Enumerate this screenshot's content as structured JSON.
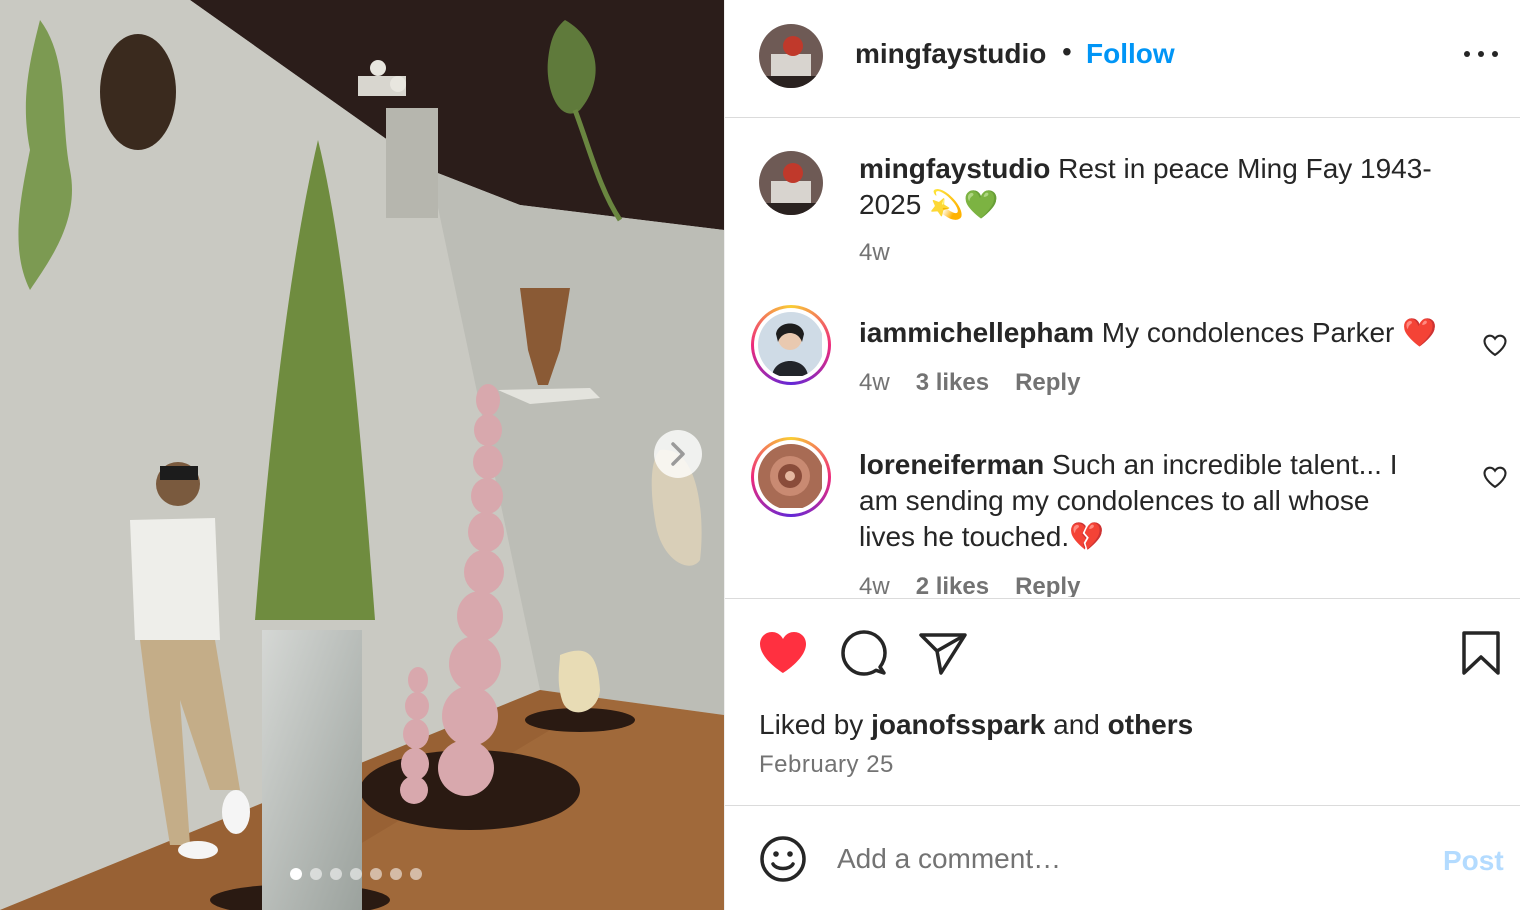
{
  "post": {
    "author": "mingfaystudio",
    "separator": "•",
    "follow_label": "Follow",
    "more_icon": "more-horizontal-icon"
  },
  "media": {
    "slide_count": 7,
    "active_slide": 1,
    "next_icon": "chevron-right-icon"
  },
  "caption": {
    "username": "mingfaystudio",
    "text_line1": " Rest in peace Ming Fay 1943-",
    "text_line2": "2025 💫💚",
    "age": "4w"
  },
  "comments": [
    {
      "username": "iammichellepham",
      "text": " My condolences Parker ❤️",
      "age": "4w",
      "likes": "3 likes",
      "reply_label": "Reply"
    },
    {
      "username": "loreneiferman",
      "text_line1": " Such an incredible talent... I",
      "text_line2": "am sending my condolences to all whose",
      "text_line3": "lives he touched.💔",
      "age": "4w",
      "likes": "2 likes",
      "reply_label": "Reply"
    }
  ],
  "actions": {
    "like_icon": "heart-filled-icon",
    "comment_icon": "comment-icon",
    "share_icon": "share-icon",
    "save_icon": "bookmark-icon",
    "like_color": "#ff3040"
  },
  "likes_summary": {
    "prefix": "Liked by ",
    "user": "joanofsspark",
    "middle": " and ",
    "others": "others"
  },
  "date": "February 25",
  "composer": {
    "placeholder": "Add a comment…",
    "post_label": "Post",
    "emoji_icon": "emoji-icon"
  },
  "colors": {
    "accent": "#0095f6",
    "post_disabled": "#b3dbff",
    "secondary_text": "#737373"
  }
}
